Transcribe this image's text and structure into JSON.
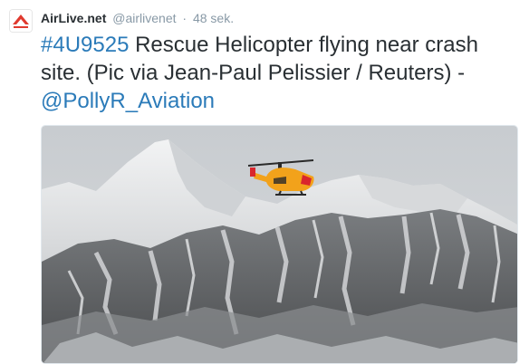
{
  "tweet": {
    "author_name": "AirLive.net",
    "author_handle": "@airlivenet",
    "separator": "·",
    "time": "48 sek.",
    "hashtag": "#4U9525",
    "text_main": " Rescue Helicopter flying near crash site. (Pic via Jean-Paul Pelissier / Reuters)   - ",
    "mention": "@PollyR_Aviation"
  },
  "avatar": {
    "icon": "airlive-logo-icon",
    "brand_color": "#e03a2f"
  },
  "photo": {
    "subject": "helicopter-photo",
    "heli_color": "#f2a21b",
    "heli_accent": "#d9262d"
  },
  "colors": {
    "link": "#2b7bb9",
    "muted": "#8899a6",
    "text": "#292f33"
  }
}
